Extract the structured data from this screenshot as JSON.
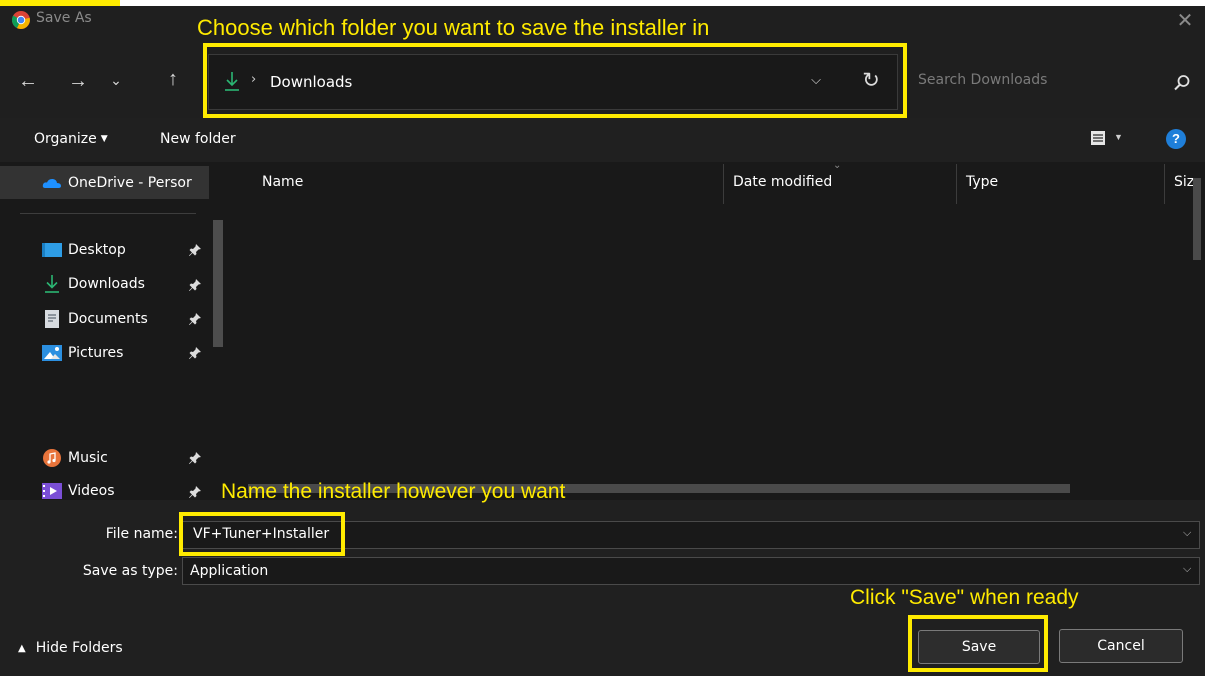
{
  "window": {
    "title": "Save As",
    "app_icon": "chrome-logo"
  },
  "nav": {
    "back_icon": "arrow-left-icon",
    "forward_icon": "arrow-right-icon",
    "recent_icon": "chevron-down-icon",
    "up_icon": "arrow-up-icon"
  },
  "address": {
    "path": "Downloads",
    "separator": "›"
  },
  "search": {
    "placeholder": "Search Downloads"
  },
  "toolbar": {
    "organize_label": "Organize",
    "new_folder_label": "New folder"
  },
  "sidebar": {
    "items": [
      {
        "label": "OneDrive - Persor",
        "icon": "onedrive-icon",
        "pinned": false
      },
      {
        "label": "Desktop",
        "icon": "desktop-icon",
        "pinned": true
      },
      {
        "label": "Downloads",
        "icon": "download-icon",
        "pinned": true
      },
      {
        "label": "Documents",
        "icon": "documents-icon",
        "pinned": true
      },
      {
        "label": "Pictures",
        "icon": "pictures-icon",
        "pinned": true
      },
      {
        "label": "Music",
        "icon": "music-icon",
        "pinned": true
      },
      {
        "label": "Videos",
        "icon": "videos-icon",
        "pinned": true
      }
    ]
  },
  "file_list": {
    "columns": [
      "Name",
      "Date modified",
      "Type",
      "Size"
    ]
  },
  "form": {
    "filename_label": "File name:",
    "filename_value": "VF+Tuner+Installer",
    "savetype_label": "Save as type:",
    "savetype_value": "Application"
  },
  "footer": {
    "hide_folders_label": "Hide Folders",
    "save_label": "Save",
    "cancel_label": "Cancel"
  },
  "annotations": {
    "folder_hint": "Choose which folder you want to save the installer in",
    "name_hint": "Name the installer however you want",
    "save_hint": "Click \"Save\" when ready",
    "highlight_color": "#ffeb00"
  },
  "colors": {
    "accent_blue": "#1f7fd9",
    "download_green": "#2bb673"
  }
}
